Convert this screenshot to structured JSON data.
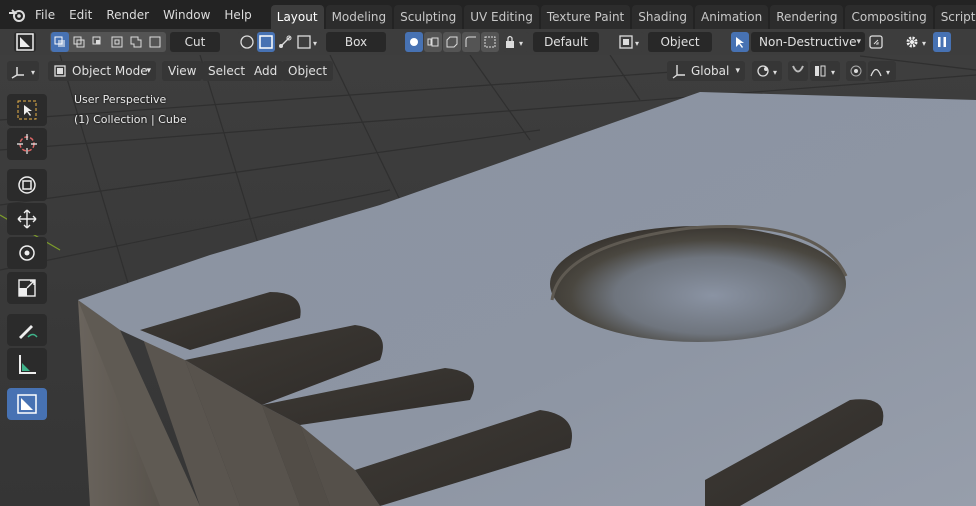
{
  "menu": {
    "items": [
      "File",
      "Edit",
      "Render",
      "Window",
      "Help"
    ]
  },
  "workspaces": {
    "tabs": [
      "Layout",
      "Modeling",
      "Sculpting",
      "UV Editing",
      "Texture Paint",
      "Shading",
      "Animation",
      "Rendering",
      "Compositing",
      "Scripting"
    ],
    "active": "Layout",
    "add_label": "+"
  },
  "toolbar": {
    "operation_label": "Cut",
    "shape_label": "Box",
    "cutter_label": "Default",
    "pivot_label": "Object",
    "mode_label": "Non-Destructive"
  },
  "viewport_header": {
    "mode_label": "Object Mode",
    "view_label": "View",
    "select_label": "Select",
    "add_label": "Add",
    "object_label": "Object",
    "transform_orientation": "Global"
  },
  "viewport": {
    "perspective_label": "User Perspective",
    "collection_label": "(1) Collection | Cube"
  },
  "tools": [
    "select-box-icon",
    "cursor-icon",
    "move-all-icon",
    "move-icon",
    "rotate-icon",
    "scale-icon",
    "annotate-icon",
    "measure-icon",
    "boxcutter-icon"
  ],
  "colors": {
    "accent": "#4772b3",
    "topbar": "#232323",
    "toolbar": "#3d3d3d",
    "viewport_bg": "#3b3b3b",
    "surface": "#8f97a5"
  }
}
